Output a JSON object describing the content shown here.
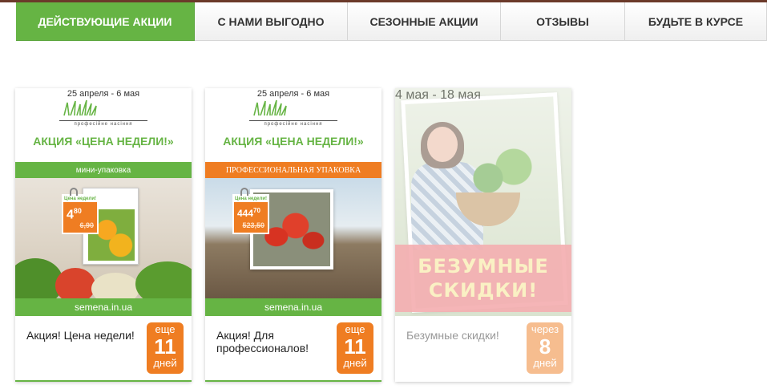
{
  "tabs": [
    {
      "label": "Действующие акции",
      "active": true
    },
    {
      "label": "С нами выгодно",
      "active": false
    },
    {
      "label": "Сезонные акции",
      "active": false
    },
    {
      "label": "Отзывы",
      "active": false
    },
    {
      "label": "Будьте в курсе",
      "active": false
    }
  ],
  "cards": [
    {
      "date": "25 апреля - 6 мая",
      "logo_tag": "професійне насіння",
      "promo_title": "Акция «ЦЕНА НЕДЕЛИ!»",
      "pack_label": "мини-упаковка",
      "price_header": "Цена недели!",
      "price_new": "4",
      "price_new_cents": "80",
      "price_old": "6,90",
      "site": "semena.in.ua",
      "text": "Акция! Цена недели!",
      "badge_top": "еще",
      "badge_num": "11",
      "badge_unit": "дней"
    },
    {
      "date": "25 апреля - 6 мая",
      "logo_tag": "професійне насіння",
      "promo_title": "Акция «ЦЕНА НЕДЕЛИ!»",
      "pack_label": "Профессиональная упаковка",
      "price_header": "Цена недели!",
      "price_new": "444",
      "price_new_cents": "70",
      "price_old": "523,50",
      "site": "semena.in.ua",
      "text": "Акция! Для профессионалов!",
      "badge_top": "еще",
      "badge_num": "11",
      "badge_unit": "дней"
    },
    {
      "date": "4 мая - 18 мая",
      "headline_1": "БЕЗУМНЫЕ",
      "headline_2": "СКИДКИ!",
      "text": "Безумные скидки!",
      "badge_top": "через",
      "badge_num": "8",
      "badge_unit": "дней"
    }
  ],
  "colors": {
    "green": "#66b444",
    "orange": "#ef7d22",
    "pink": "#ea6266"
  }
}
